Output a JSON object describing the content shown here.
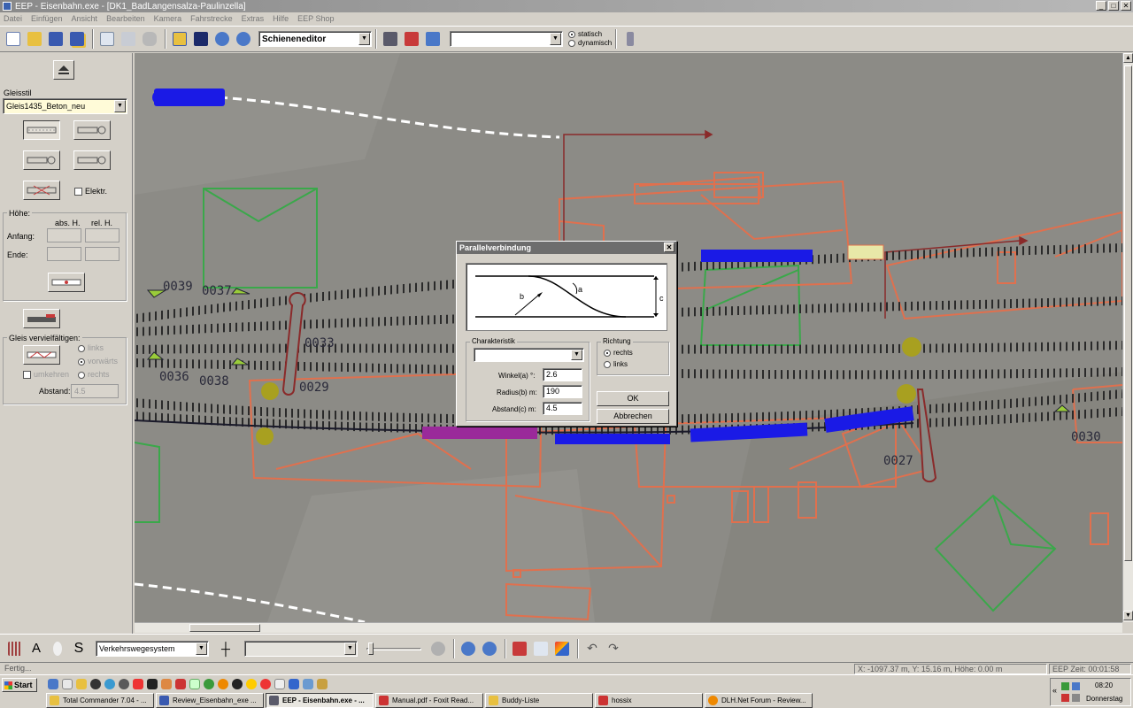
{
  "window": {
    "title": "EEP - Eisenbahn.exe - [DK1_BadLangensalza-Paulinzella]",
    "min": "_",
    "max": "□",
    "close": "✕"
  },
  "menu": [
    "Datei",
    "Einfügen",
    "Ansicht",
    "Bearbeiten",
    "Kamera",
    "Fahrstrecke",
    "Extras",
    "Hilfe",
    "EEP Shop"
  ],
  "toolbar": {
    "editor_select": "Schieneneditor",
    "search_select": "",
    "mode_static": "statisch",
    "mode_dynamic": "dynamisch",
    "mode_selected": "statisch"
  },
  "left_panel": {
    "gleisstil_label": "Gleisstil",
    "gleisstil_value": "Gleis1435_Beton_neu",
    "elektr_label": "Elektr.",
    "hoehe_label": "Höhe:",
    "abs_h_label": "abs. H.",
    "rel_h_label": "rel. H.",
    "anfang_label": "Anfang:",
    "ende_label": "Ende:",
    "vervielfaeltigen_label": "Gleis vervielfältigen:",
    "opt_links": "links",
    "opt_vorwaerts": "vorwärts",
    "opt_rechts": "rechts",
    "umkehren_label": "umkehren",
    "abstand_label": "Abstand:",
    "abstand_value": "4.5"
  },
  "dialog": {
    "title": "Parallelverbindung",
    "close": "✕",
    "diagram_label_a": "a",
    "diagram_label_b": "b",
    "diagram_label_c": "c",
    "charakteristik_label": "Charakteristik",
    "charakteristik_value": "",
    "winkel_label": "Winkel(a) °:",
    "winkel_value": "2.6",
    "radius_label": "Radius(b) m:",
    "radius_value": "190",
    "abstand_label": "Abstand(c) m:",
    "abstand_value": "4.5",
    "richtung_label": "Richtung",
    "richtung_rechts": "rechts",
    "richtung_links": "links",
    "richtung_selected": "rechts",
    "ok_label": "OK",
    "cancel_label": "Abbrechen"
  },
  "viewport_labels": [
    "0039",
    "0037",
    "0033",
    "0036",
    "0038",
    "0029",
    "0027",
    "0030"
  ],
  "bottom_toolbar": {
    "system_select": "Verkehrswegesystem",
    "object_select": ""
  },
  "status": {
    "left": "Fertig...",
    "coords": "X: -1097.37 m, Y: 15.16 m, Höhe: 0.00 m",
    "time": "EEP Zeit: 00:01:58"
  },
  "taskbar": {
    "start": "Start",
    "tasks": [
      {
        "label": "Total Commander 7.04 - ...",
        "active": false
      },
      {
        "label": "Review_Eisenbahn_exe ...",
        "active": false
      },
      {
        "label": "EEP - Eisenbahn.exe - ...",
        "active": true
      },
      {
        "label": "Manual.pdf - Foxit Read...",
        "active": false
      },
      {
        "label": "Buddy-Liste",
        "active": false
      },
      {
        "label": "hossix",
        "active": false
      },
      {
        "label": "DLH.Net Forum - Review...",
        "active": false
      }
    ],
    "clock": "08:20",
    "day": "Donnerstag"
  },
  "colors": {
    "track_blue": "#1a1ae6",
    "track_purple": "#9a2a9a",
    "building_outline": "#e0704e",
    "zone_green": "#3aa84a",
    "signal_yellow": "#a8a020"
  }
}
